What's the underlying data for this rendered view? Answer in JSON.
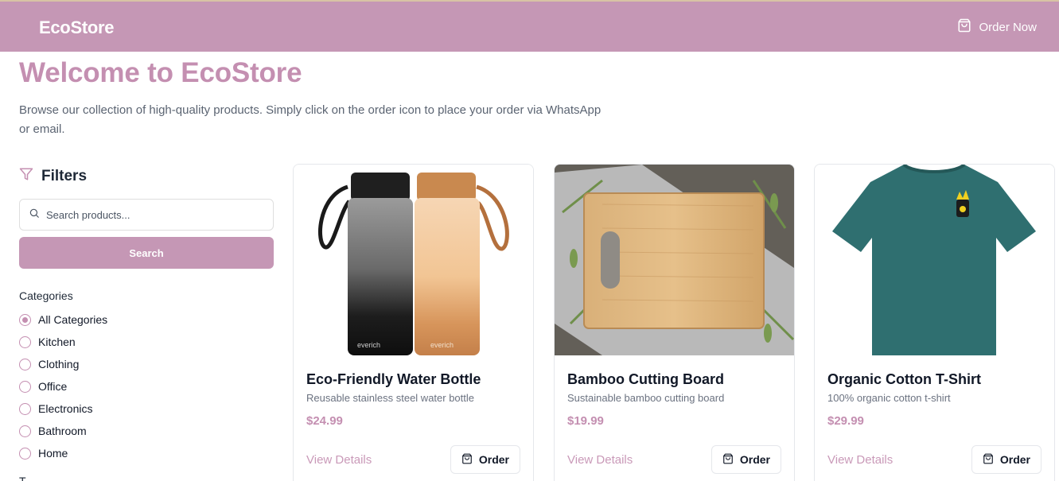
{
  "header": {
    "brand": "EcoStore",
    "order_now": "Order Now"
  },
  "hero": {
    "title": "Welcome to EcoStore",
    "subtitle": "Browse our collection of high-quality products. Simply click on the order icon to place your order via WhatsApp or email."
  },
  "filters": {
    "title": "Filters",
    "search_placeholder": "Search products...",
    "search_value": "",
    "search_button": "Search",
    "categories_heading": "Categories",
    "categories": [
      {
        "label": "All Categories",
        "selected": true
      },
      {
        "label": "Kitchen",
        "selected": false
      },
      {
        "label": "Clothing",
        "selected": false
      },
      {
        "label": "Office",
        "selected": false
      },
      {
        "label": "Electronics",
        "selected": false
      },
      {
        "label": "Bathroom",
        "selected": false
      },
      {
        "label": "Home",
        "selected": false
      }
    ],
    "next_heading_partial": "T"
  },
  "products": [
    {
      "name": "Eco-Friendly Water Bottle",
      "description": "Reusable stainless steel water bottle",
      "price": "$24.99",
      "view_label": "View Details",
      "order_label": "Order"
    },
    {
      "name": "Bamboo Cutting Board",
      "description": "Sustainable bamboo cutting board",
      "price": "$19.99",
      "view_label": "View Details",
      "order_label": "Order"
    },
    {
      "name": "Organic Cotton T-Shirt",
      "description": "100% organic cotton t-shirt",
      "price": "$29.99",
      "view_label": "View Details",
      "order_label": "Order"
    }
  ],
  "colors": {
    "brand": "#c597b5",
    "accent_text": "#c48fb1"
  }
}
